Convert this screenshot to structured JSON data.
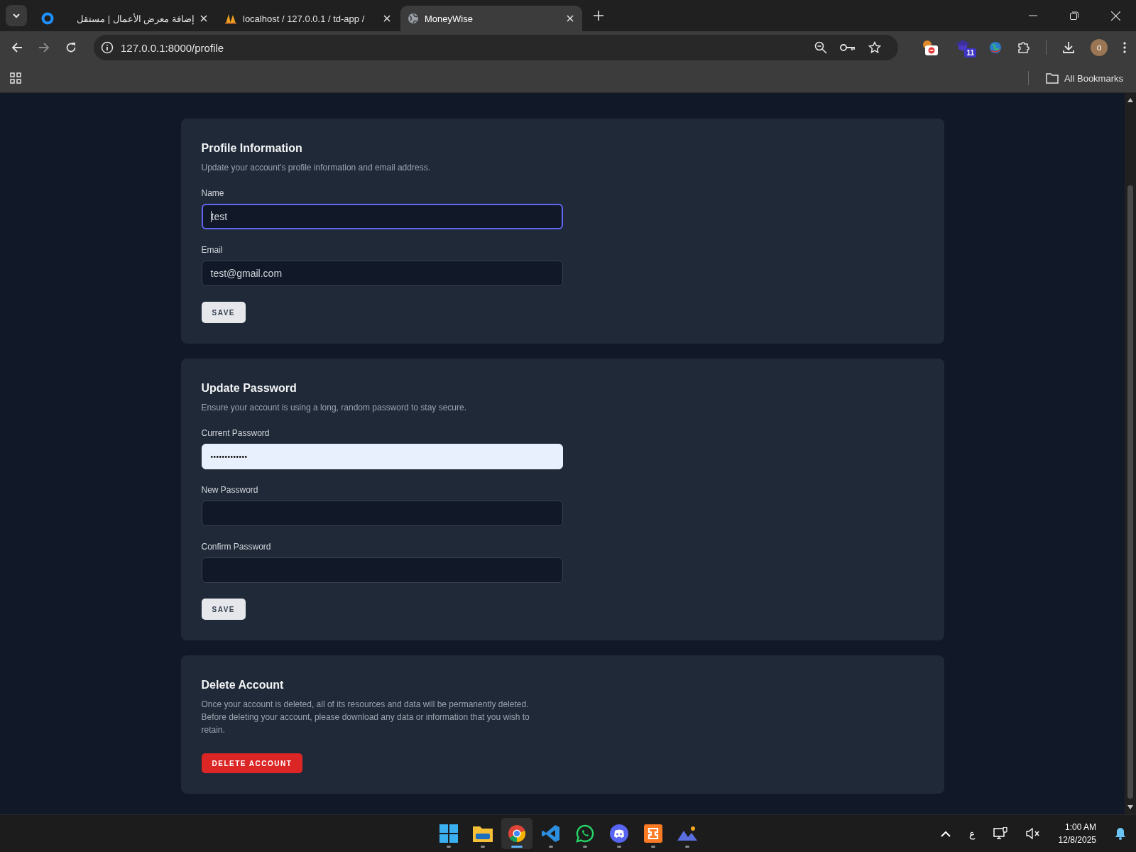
{
  "browser": {
    "tabs": [
      {
        "title": "إضافة معرض الأعمال | مستقل",
        "kind": "ring",
        "selected": false
      },
      {
        "title": "localhost / 127.0.0.1 / td-app /",
        "kind": "sails",
        "selected": false
      },
      {
        "title": "MoneyWise",
        "kind": "globe",
        "selected": true
      }
    ],
    "url": "127.0.0.1:8000/profile",
    "extension_badge": "11",
    "avatar": "o",
    "bookmarks_label": "All Bookmarks"
  },
  "sections": [
    {
      "title": "Profile Information",
      "description": "Update your account's profile information and email address.",
      "fields": [
        {
          "label": "Name",
          "value": "test",
          "focused": true,
          "autofilled": false
        },
        {
          "label": "Email",
          "value": "test@gmail.com",
          "focused": false,
          "autofilled": false
        }
      ],
      "button": {
        "label": "SAVE",
        "kind": "save"
      }
    },
    {
      "title": "Update Password",
      "description": "Ensure your account is using a long, random password to stay secure.",
      "fields": [
        {
          "label": "Current Password",
          "value": "•••••••••••••",
          "focused": false,
          "autofilled": true
        },
        {
          "label": "New Password",
          "focused": false,
          "autofilled": false
        },
        {
          "label": "Confirm Password",
          "focused": false,
          "autofilled": false
        }
      ],
      "button": {
        "label": "SAVE",
        "kind": "save"
      }
    },
    {
      "title": "Delete Account",
      "description": "Once your account is deleted, all of its resources and data will be permanently deleted. Before deleting your account, please download any data or information that you wish to retain.",
      "button": {
        "label": "DELETE ACCOUNT",
        "kind": "danger"
      }
    }
  ],
  "taskbar": {
    "apps": [
      {
        "kind": "windows",
        "active": false
      },
      {
        "kind": "folder",
        "active": false
      },
      {
        "kind": "chrome",
        "active": true
      },
      {
        "kind": "code",
        "active": false
      },
      {
        "kind": "chat",
        "active": false
      },
      {
        "kind": "discord",
        "active": false
      },
      {
        "kind": "xampp",
        "active": false
      },
      {
        "kind": "photos",
        "active": false
      }
    ],
    "language": "ع",
    "time": "1:00 AM",
    "date": "12/8/2025"
  }
}
